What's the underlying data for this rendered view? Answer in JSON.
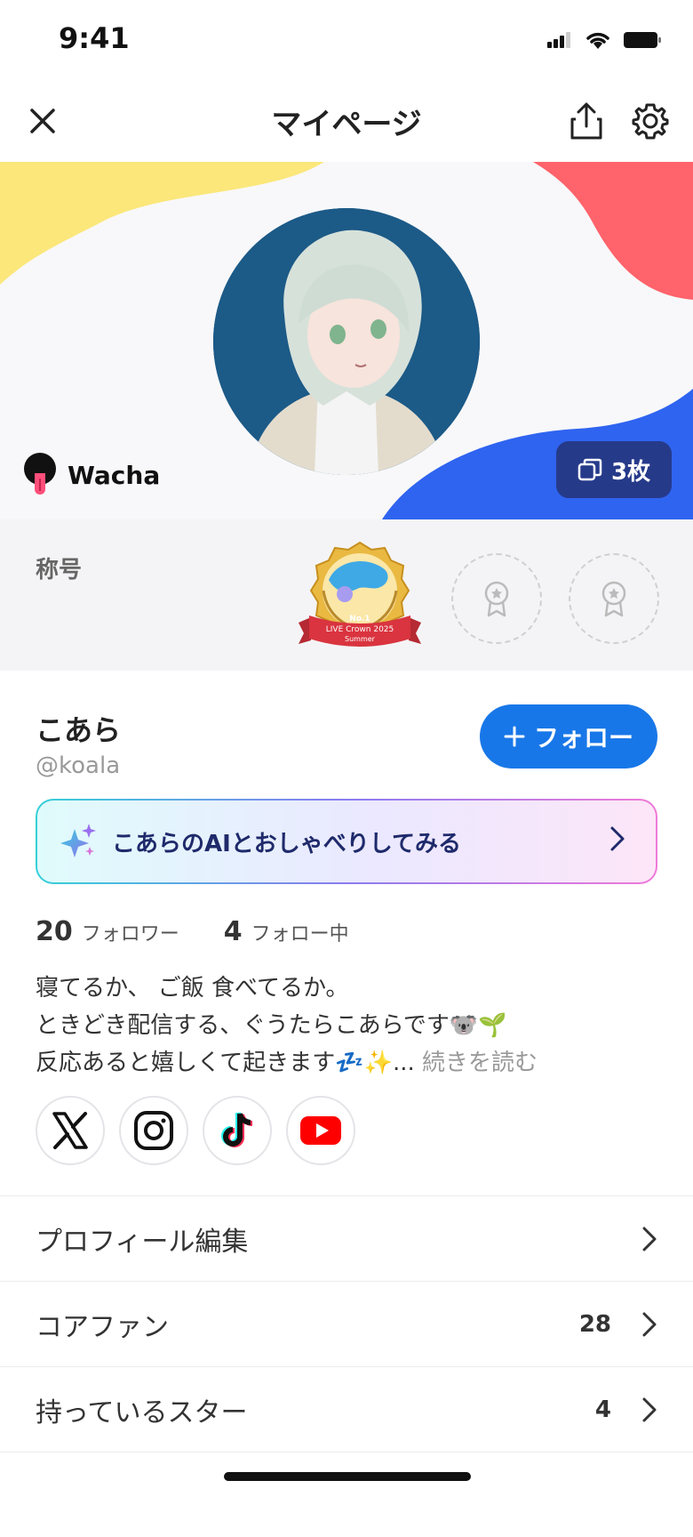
{
  "status_bar": {
    "time": "9:41"
  },
  "nav": {
    "title": "マイページ"
  },
  "hero": {
    "channel_name": "Wacha",
    "card_count": "3枚"
  },
  "titles_section": {
    "label": "称号",
    "badge": {
      "rank": "No.1",
      "line1": "LIVE Crown 2025",
      "line2": "Summer"
    }
  },
  "profile": {
    "name": "こあら",
    "handle": "@koala",
    "follow_label": "フォロー",
    "ai_chat_label": "こあらのAIとおしゃべりしてみる",
    "followers_count": "20",
    "followers_label": "フォロワー",
    "following_count": "4",
    "following_label": "フォロー中",
    "bio": {
      "line1": "寝てるか、 ご飯 食べてるか。",
      "line2": "ときどき配信する、ぐうたらこあらです🐨🌱",
      "line3": "反応あると嬉しくて起きます💤✨...",
      "read_more": "続きを読む"
    },
    "socials": [
      "x-icon",
      "instagram-icon",
      "tiktok-icon",
      "youtube-icon"
    ]
  },
  "menu": [
    {
      "label": "プロフィール編集",
      "value": ""
    },
    {
      "label": "コアファン",
      "value": "28"
    },
    {
      "label": "持っているスター",
      "value": "4"
    }
  ],
  "colors": {
    "accent_blue": "#1877e8",
    "hero_yellow": "#fbe77a",
    "hero_red": "#ff636b",
    "hero_blue": "#2f64f0",
    "badge_navy": "#263a8a"
  }
}
